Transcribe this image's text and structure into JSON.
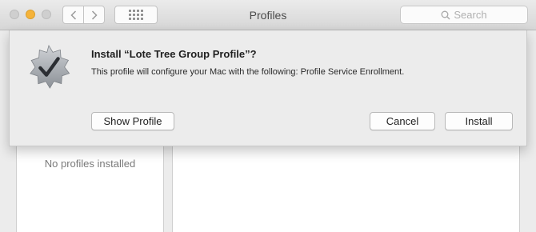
{
  "window": {
    "title": "Profiles",
    "search_placeholder": "Search"
  },
  "icons": {
    "back": "chevron-left-icon",
    "forward": "chevron-right-icon",
    "show_all": "grid-icon",
    "search": "search-icon",
    "badge": "checkmark-badge-icon"
  },
  "sidebar": {
    "empty_text": "No profiles installed"
  },
  "dialog": {
    "title": "Install “Lote Tree Group Profile”?",
    "message": "This profile will configure your Mac with the following: Profile Service Enrollment.",
    "show_profile_label": "Show Profile",
    "cancel_label": "Cancel",
    "install_label": "Install"
  },
  "colors": {
    "minimize_light": "#f5b33a",
    "inactive_light": "#cfcfcf"
  }
}
